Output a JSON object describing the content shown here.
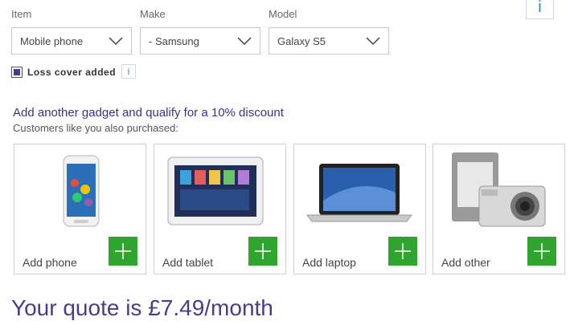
{
  "fields": {
    "item": {
      "label": "Item",
      "value": "Mobile phone"
    },
    "make": {
      "label": "Make",
      "value": "- Samsung"
    },
    "model": {
      "label": "Model",
      "value": "Galaxy S5"
    }
  },
  "info_glyph": "i",
  "loss_cover": {
    "label": "Loss cover added",
    "checked": true
  },
  "promo": {
    "headline": "Add another gadget and qualify for a 10% discount",
    "subline": "Customers like you also purchased:"
  },
  "gadgets": [
    {
      "label": "Add phone",
      "icon": "phone-image"
    },
    {
      "label": "Add tablet",
      "icon": "tablet-image"
    },
    {
      "label": "Add laptop",
      "icon": "laptop-image"
    },
    {
      "label": "Add other",
      "icon": "ereader-camera-image"
    }
  ],
  "quote": "Your quote is £7.49/month",
  "colors": {
    "accent": "#4a3b8c",
    "add_button": "#2fa52f",
    "info": "#1b8ccd"
  }
}
